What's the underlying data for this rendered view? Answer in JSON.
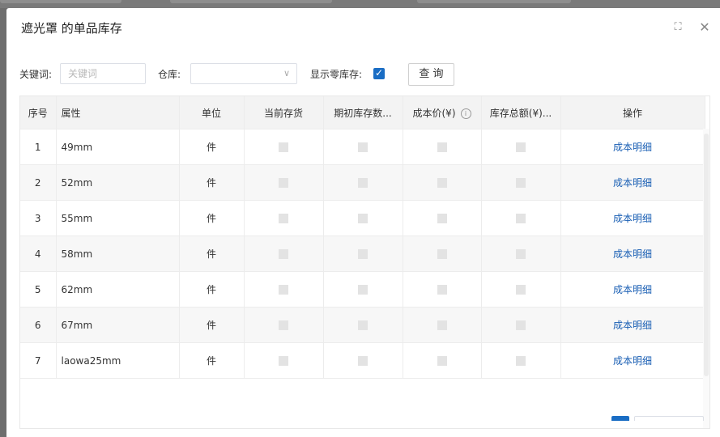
{
  "dialog": {
    "title": "遮光罩 的单品库存"
  },
  "filters": {
    "keyword_label": "关键词:",
    "keyword_placeholder": "关键词",
    "keyword_value": "",
    "warehouse_label": "仓库:",
    "warehouse_value": "",
    "zero_stock_label": "显示零库存:",
    "zero_stock_checked": true,
    "query_button": "查 询"
  },
  "table": {
    "columns": [
      "序号",
      "属性",
      "单位",
      "当前存货",
      "期初库存数...",
      "成本价(¥)",
      "库存总额(¥)...",
      "操作"
    ],
    "rows": [
      {
        "index": "1",
        "attr": "49mm",
        "unit": "件",
        "action": "成本明细"
      },
      {
        "index": "2",
        "attr": "52mm",
        "unit": "件",
        "action": "成本明细"
      },
      {
        "index": "3",
        "attr": "55mm",
        "unit": "件",
        "action": "成本明细"
      },
      {
        "index": "4",
        "attr": "58mm",
        "unit": "件",
        "action": "成本明细"
      },
      {
        "index": "5",
        "attr": "62mm",
        "unit": "件",
        "action": "成本明细"
      },
      {
        "index": "6",
        "attr": "67mm",
        "unit": "件",
        "action": "成本明细"
      },
      {
        "index": "7",
        "attr": "laowa25mm",
        "unit": "件",
        "action": "成本明细"
      }
    ]
  },
  "icons": {
    "expand": "expand-icon",
    "close": "close-icon",
    "dropdown": "chevron-down-icon",
    "info": "info-icon",
    "check": "check-icon"
  },
  "colors": {
    "accent": "#1a6dc4",
    "link": "#1a5fb4"
  }
}
